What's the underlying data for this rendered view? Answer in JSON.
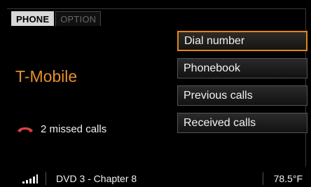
{
  "tabs": [
    {
      "label": "PHONE",
      "active": true
    },
    {
      "label": "OPTION",
      "active": false
    }
  ],
  "carrier": "T-Mobile",
  "missed_calls": {
    "text": "2 missed calls",
    "icon": "handset-icon"
  },
  "menu": [
    {
      "label": "Dial number",
      "selected": true
    },
    {
      "label": "Phonebook",
      "selected": false
    },
    {
      "label": "Previous calls",
      "selected": false
    },
    {
      "label": "Received calls",
      "selected": false
    }
  ],
  "status": {
    "signal_icon": "signal-strength-icon",
    "media": "DVD 3 - Chapter 8",
    "temperature": "78.5°F"
  },
  "colors": {
    "accent": "#e0861c",
    "carrier": "#e6902a",
    "missed_icon": "#e04040"
  }
}
